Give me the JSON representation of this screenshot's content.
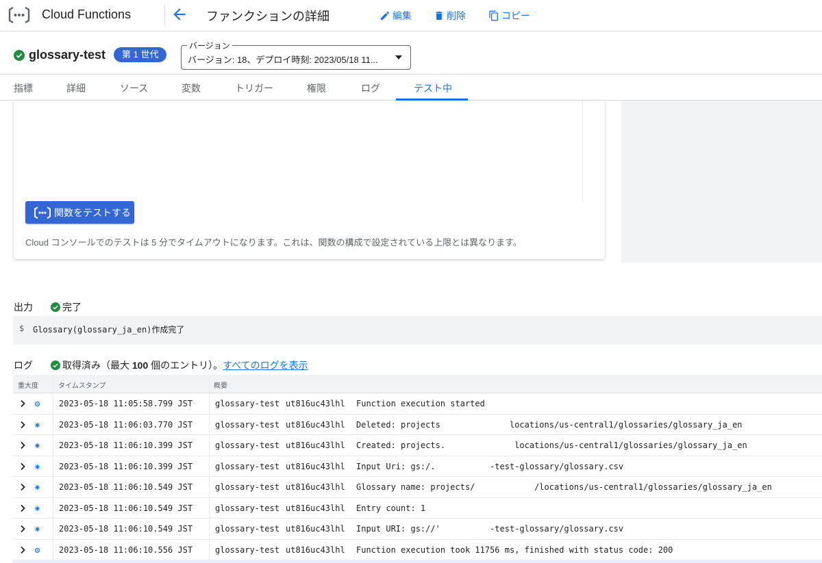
{
  "app": {
    "title": "Cloud Functions"
  },
  "header": {
    "page_title": "ファンクションの詳細",
    "actions": [
      {
        "label": "編集",
        "icon": "pencil-icon"
      },
      {
        "label": "削除",
        "icon": "trash-icon"
      },
      {
        "label": "コピー",
        "icon": "copy-icon"
      }
    ]
  },
  "function": {
    "name": "glossary-test",
    "generation_badge": "第 1 世代",
    "version_label": "バージョン",
    "version_value": "バージョン: 18、デプロイ時刻: 2023/05/18 11..."
  },
  "tabs": [
    {
      "label": "指標"
    },
    {
      "label": "詳細"
    },
    {
      "label": "ソース"
    },
    {
      "label": "変数"
    },
    {
      "label": "トリガー"
    },
    {
      "label": "権限"
    },
    {
      "label": "ログ"
    },
    {
      "label": "テスト中",
      "active": true
    }
  ],
  "test": {
    "button_label": "関数をテストする",
    "timeout_note": "Cloud コンソールでのテストは 5 分でタイムアウトになります。これは、関数の構成で設定されている上限とは異なります。"
  },
  "output": {
    "label": "出力",
    "status": "完了",
    "prompt": "$",
    "text": "Glossary(glossary_ja_en)作成完了"
  },
  "logs": {
    "label": "ログ",
    "status_prefix": "取得済み（最大 ",
    "status_count": "100",
    "status_suffix": " 個のエントリ）。",
    "link": "すべてのログを表示",
    "columns": {
      "severity": "重大度",
      "timestamp": "タイムスタンプ",
      "summary": "概要"
    },
    "rows": [
      {
        "severity": "debug",
        "timestamp": "2023-05-18 11:05:58.799 JST",
        "function": "glossary-test",
        "execution_id": "ut816uc43lhl",
        "message": "Function execution started"
      },
      {
        "severity": "default",
        "timestamp": "2023-05-18 11:06:03.770 JST",
        "function": "glossary-test",
        "execution_id": "ut816uc43lhl",
        "message": "Deleted: projects              locations/us-central1/glossaries/glossary_ja_en"
      },
      {
        "severity": "default",
        "timestamp": "2023-05-18 11:06:10.399 JST",
        "function": "glossary-test",
        "execution_id": "ut816uc43lhl",
        "message": "Created: projects.              locations/us-central1/glossaries/glossary_ja_en"
      },
      {
        "severity": "default",
        "timestamp": "2023-05-18 11:06:10.399 JST",
        "function": "glossary-test",
        "execution_id": "ut816uc43lhl",
        "message": "Input Uri: gs:/.           -test-glossary/glossary.csv"
      },
      {
        "severity": "default",
        "timestamp": "2023-05-18 11:06:10.549 JST",
        "function": "glossary-test",
        "execution_id": "ut816uc43lhl",
        "message": "Glossary name: projects/            /locations/us-central1/glossaries/glossary_ja_en"
      },
      {
        "severity": "default",
        "timestamp": "2023-05-18 11:06:10.549 JST",
        "function": "glossary-test",
        "execution_id": "ut816uc43lhl",
        "message": "Entry count: 1"
      },
      {
        "severity": "default",
        "timestamp": "2023-05-18 11:06:10.549 JST",
        "function": "glossary-test",
        "execution_id": "ut816uc43lhl",
        "message": "Input URI: gs://'          -test-glossary/glossary.csv"
      },
      {
        "severity": "debug",
        "timestamp": "2023-05-18 11:06:10.556 JST",
        "function": "glossary-test",
        "execution_id": "ut816uc43lhl",
        "message": "Function execution took 11756 ms, finished with status code: 200"
      }
    ]
  },
  "colors": {
    "accent": "#1a73e8",
    "badge": "#3367d6",
    "success": "#1e8e3e"
  }
}
